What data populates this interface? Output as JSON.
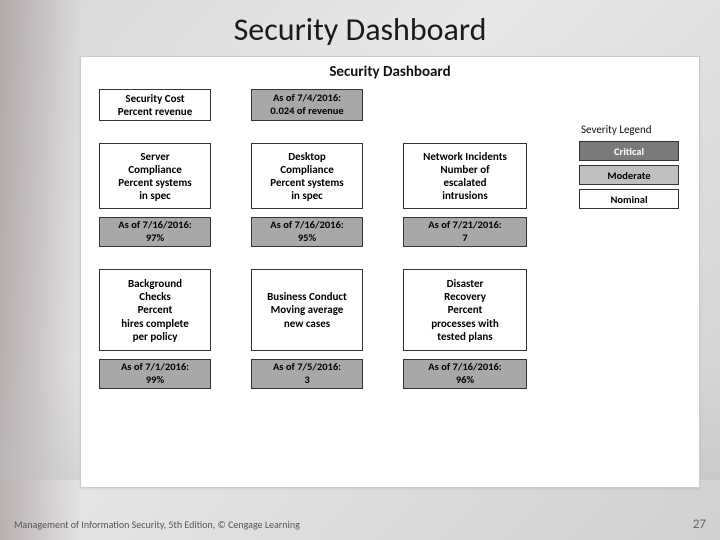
{
  "slide": {
    "title": "Security Dashboard"
  },
  "panel": {
    "title": "Security Dashboard"
  },
  "metrics": {
    "r1c1": {
      "l1": "Security Cost",
      "l2": "Percent revenue"
    },
    "r1c1_date": {
      "l1": "As of 7/4/2016:",
      "l2": "0.024 of revenue"
    },
    "r2c1": {
      "l1": "Server",
      "l2": "Compliance",
      "l3": "Percent systems",
      "l4": "in spec"
    },
    "r2c1_date": {
      "l1": "As of 7/16/2016:",
      "l2": "97%"
    },
    "r2c2": {
      "l1": "Desktop",
      "l2": "Compliance",
      "l3": "Percent systems",
      "l4": "in spec"
    },
    "r2c2_date": {
      "l1": "As of 7/16/2016:",
      "l2": "95%"
    },
    "r2c3": {
      "l1": "Network Incidents",
      "l2": "Number of",
      "l3": "escalated",
      "l4": "intrusions"
    },
    "r2c3_date": {
      "l1": "As of 7/21/2016:",
      "l2": "7"
    },
    "r3c1": {
      "l1": "Background",
      "l2": "Checks",
      "l3": "Percent",
      "l4": "hires complete",
      "l5": "per policy"
    },
    "r3c1_date": {
      "l1": "As of 7/1/2016:",
      "l2": "99%"
    },
    "r3c2": {
      "l1": "Business Conduct",
      "l2": "Moving average",
      "l3": "new cases"
    },
    "r3c2_date": {
      "l1": "As of 7/5/2016:",
      "l2": "3"
    },
    "r3c3": {
      "l1": "Disaster",
      "l2": "Recovery",
      "l3": "Percent",
      "l4": "processes with",
      "l5": "tested plans"
    },
    "r3c3_date": {
      "l1": "As of 7/16/2016:",
      "l2": "96%"
    }
  },
  "legend": {
    "title": "Severity Legend",
    "critical": "Critical",
    "moderate": "Moderate",
    "nominal": "Nominal"
  },
  "footer": {
    "credit": "Management of Information Security, 5th Edition, © Cengage Learning",
    "page": "27"
  }
}
